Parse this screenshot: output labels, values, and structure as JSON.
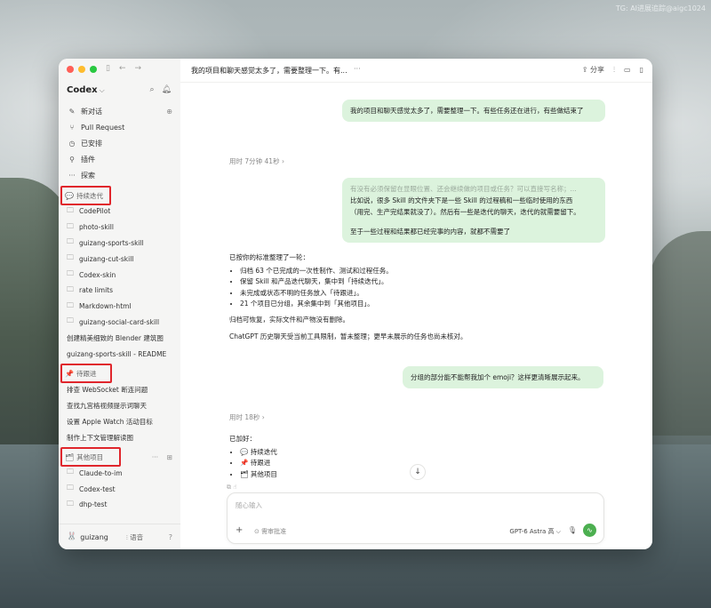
{
  "watermark": "TG: AI进展追踪@aigc1024",
  "app": {
    "name": "Codex"
  },
  "sidebar": {
    "nav": [
      {
        "label": "新对话",
        "icon": "edit-icon"
      },
      {
        "label": "Pull Request",
        "icon": "pull-request-icon"
      },
      {
        "label": "已安排",
        "icon": "clock-icon"
      },
      {
        "label": "插件",
        "icon": "plugin-icon"
      },
      {
        "label": "探索",
        "icon": "ellipsis-icon"
      }
    ],
    "sections": {
      "ongoing": {
        "title": "持续迭代",
        "icon": "💬"
      },
      "todo": {
        "title": "待跟进",
        "icon": "📌"
      },
      "other": {
        "title": "其他项目",
        "icon": "🗂"
      }
    },
    "ongoing_projects": [
      "CodePilot",
      "photo-skill",
      "guizang-sports-skill",
      "guizang-cut-skill",
      "Codex-skin",
      "rate limits",
      "Markdown-html",
      "guizang-social-card-skill"
    ],
    "ongoing_threads": [
      "创建精美细致的 Blender 建筑图",
      "guizang-sports-skill - README"
    ],
    "todo_threads": [
      "排查 WebSocket 断连问题",
      "查找九宫格视频提示词聊天",
      "设置 Apple Watch 活动目标",
      "制作上下文管理解读图"
    ],
    "other_projects": [
      "Claude-to-im",
      "Codex-test",
      "dhp-test"
    ],
    "user": {
      "name": "guizang",
      "voice": "语音",
      "avatar": "🐰"
    }
  },
  "header": {
    "title": "我的项目和聊天感觉太多了，需要整理一下。有...",
    "more": "···",
    "share": "分享"
  },
  "messages": {
    "user1": "我的项目和聊天感觉太多了，需要整理一下。有些任务还在进行，有些做结束了",
    "meta1": "用时 7分钟 41秒 ›",
    "user2_line1": "有没有必须保留在显眼位置、还会继续做的项目或任务？可以直接写名称；...",
    "user2_line2": "比如说，很多 Skill 的文件夹下是一些 Skill 的过程稿和一些临时使用的东西",
    "user2_line3": "（用完、生产完结果就没了）。然后有一些是迭代的聊天，迭代的就需要留下。",
    "user2_line4": "至于一些过程和结果都已经完事的内容，就都不需要了",
    "assistant1_intro": "已按你的标准整理了一轮：",
    "assistant1_bullets": [
      "归档 63 个已完成的一次性制作、测试和过程任务。",
      "保留 Skill 和产品迭代聊天，集中到「持续迭代」。",
      "未完成或状态不明的任务放入「待跟进」。",
      "21 个项目已分组，其余集中到「其他项目」。"
    ],
    "assistant1_note1": "归档可恢复，实际文件和产物没有删除。",
    "assistant1_note2": "ChatGPT 历史聊天受当前工具限制，暂未整理；更早未展示的任务也尚未核对。",
    "user3": "分组的部分能不能帮我加个 emoji？这样更清晰展示起来。",
    "meta2": "用时 18秒 ›",
    "assistant2_intro": "已加好：",
    "assistant2_bullets": [
      "💬 持续迭代",
      "📌 待跟进",
      "🗂 其他项目"
    ]
  },
  "composer": {
    "placeholder": "随心输入",
    "approve": "⊙ 需审批准",
    "model": "GPT-6 Astra 高 ⌵",
    "plus": "+",
    "mic": "🎙",
    "send": "⏺"
  },
  "colors": {
    "accent_green": "#4caf50",
    "bubble": "#dcf3dd",
    "highlight": "#e0262c"
  }
}
